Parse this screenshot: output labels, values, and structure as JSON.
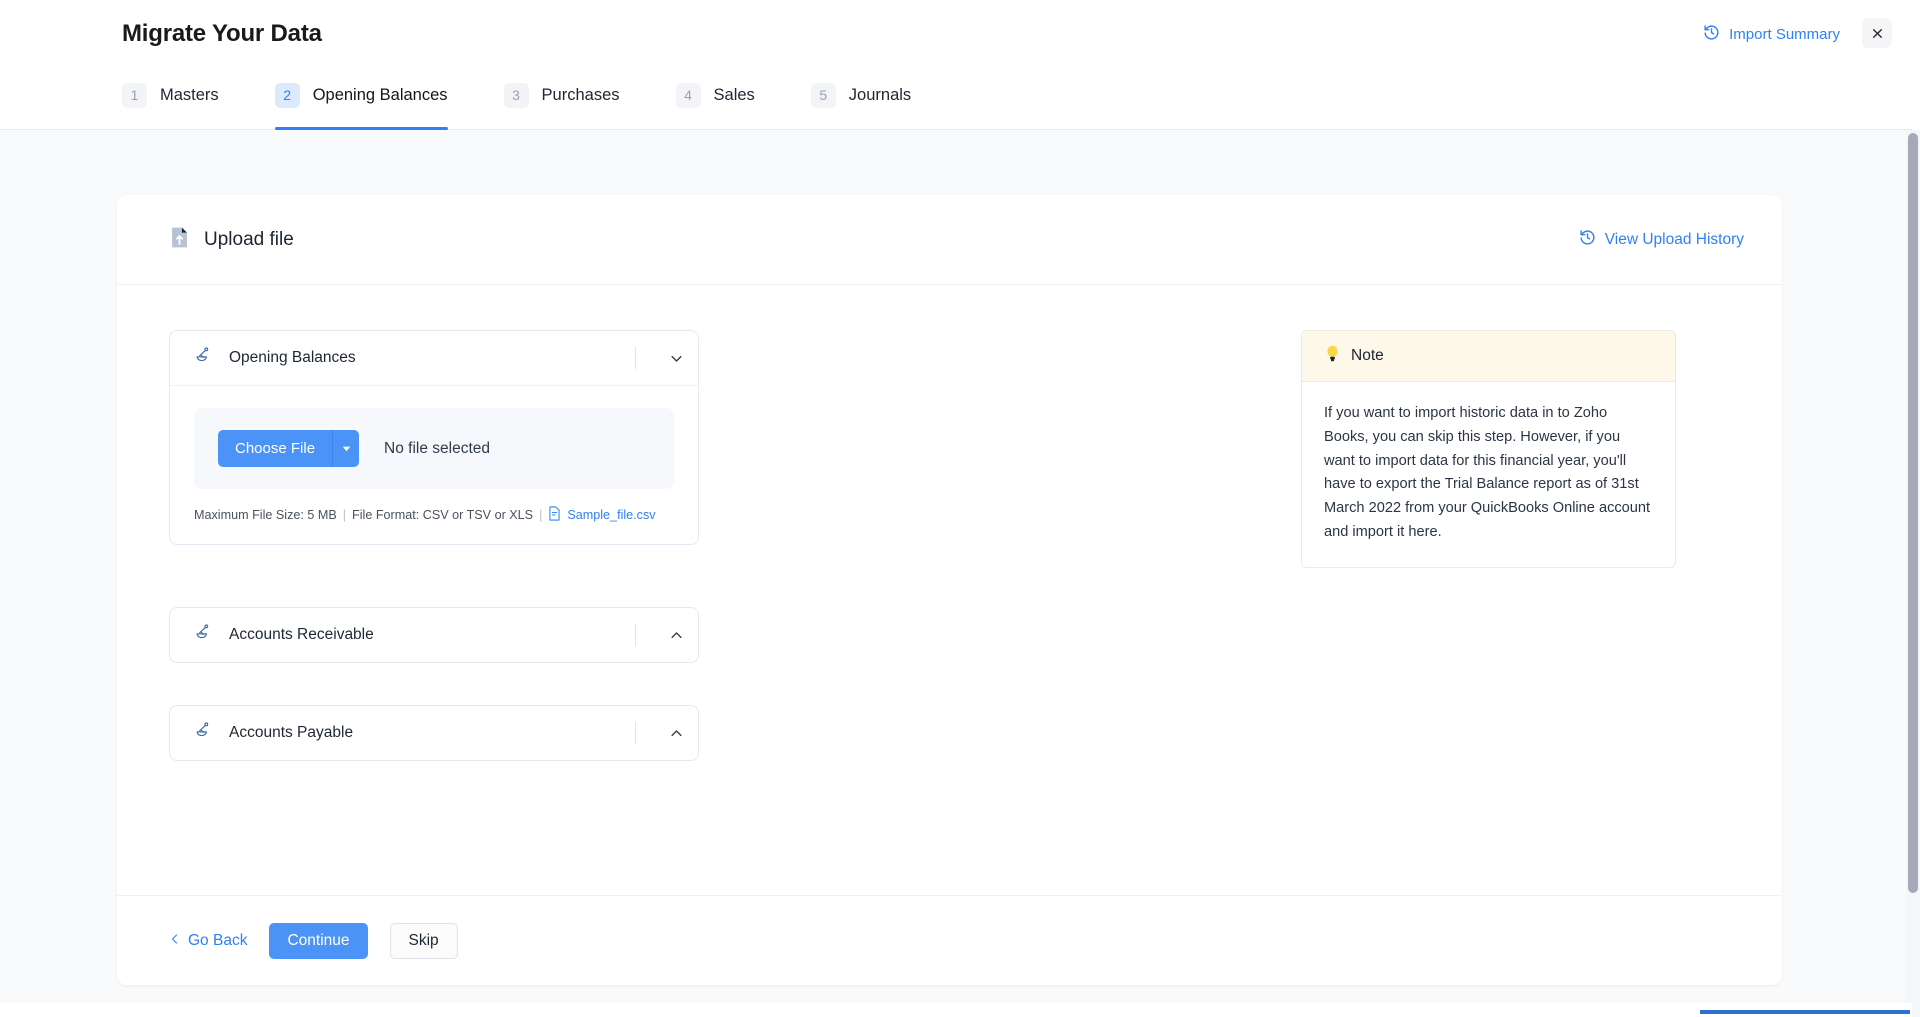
{
  "header": {
    "title": "Migrate Your Data",
    "import_summary_label": "Import Summary",
    "import_summary_icon": "history-clock-icon",
    "close_icon": "close-icon",
    "close_label": "×"
  },
  "tabs": [
    {
      "num": "1",
      "label": "Masters",
      "active": false
    },
    {
      "num": "2",
      "label": "Opening Balances",
      "active": true
    },
    {
      "num": "3",
      "label": "Purchases",
      "active": false
    },
    {
      "num": "4",
      "label": "Sales",
      "active": false
    },
    {
      "num": "5",
      "label": "Journals",
      "active": false
    }
  ],
  "card": {
    "title": "Upload file",
    "title_icon": "file-upload-icon",
    "history_label": "View Upload History",
    "history_icon": "history-clock-icon"
  },
  "sections": [
    {
      "title": "Opening Balances",
      "icon": "balance-scale-icon",
      "expanded": true,
      "chevron": "chevron-down-icon"
    },
    {
      "title": "Accounts Receivable",
      "icon": "balance-scale-icon",
      "expanded": false,
      "chevron": "chevron-up-icon"
    },
    {
      "title": "Accounts Payable",
      "icon": "balance-scale-icon",
      "expanded": false,
      "chevron": "chevron-up-icon"
    }
  ],
  "upload": {
    "choose_file_label": "Choose File",
    "dropdown_icon": "caret-down-icon",
    "no_file_label": "No file selected",
    "max_size_label": "Maximum File Size: 5 MB",
    "format_label": "File Format: CSV or TSV or XLS",
    "separator": "|",
    "sample_file_label": "Sample_file.csv",
    "sample_file_icon": "csv-document-icon"
  },
  "note": {
    "icon": "lightbulb-icon",
    "title": "Note",
    "body": "If you want to import historic data in to Zoho Books, you can skip this step. However, if you want to import data for this financial year, you'll have to export the Trial Balance report as of 31st March 2022 from your QuickBooks Online account and import it here."
  },
  "footer": {
    "go_back_label": "Go Back",
    "go_back_icon": "chevron-left-icon",
    "continue_label": "Continue",
    "skip_label": "Skip"
  },
  "colors": {
    "accent_blue": "#2f80f7",
    "button_blue": "#4b93f7",
    "active_tab_badge": "#dceafe",
    "note_header_bg": "#fdf8e9",
    "page_bg": "#f8fafc",
    "scrollbar_thumb": "#a8a8b8"
  }
}
